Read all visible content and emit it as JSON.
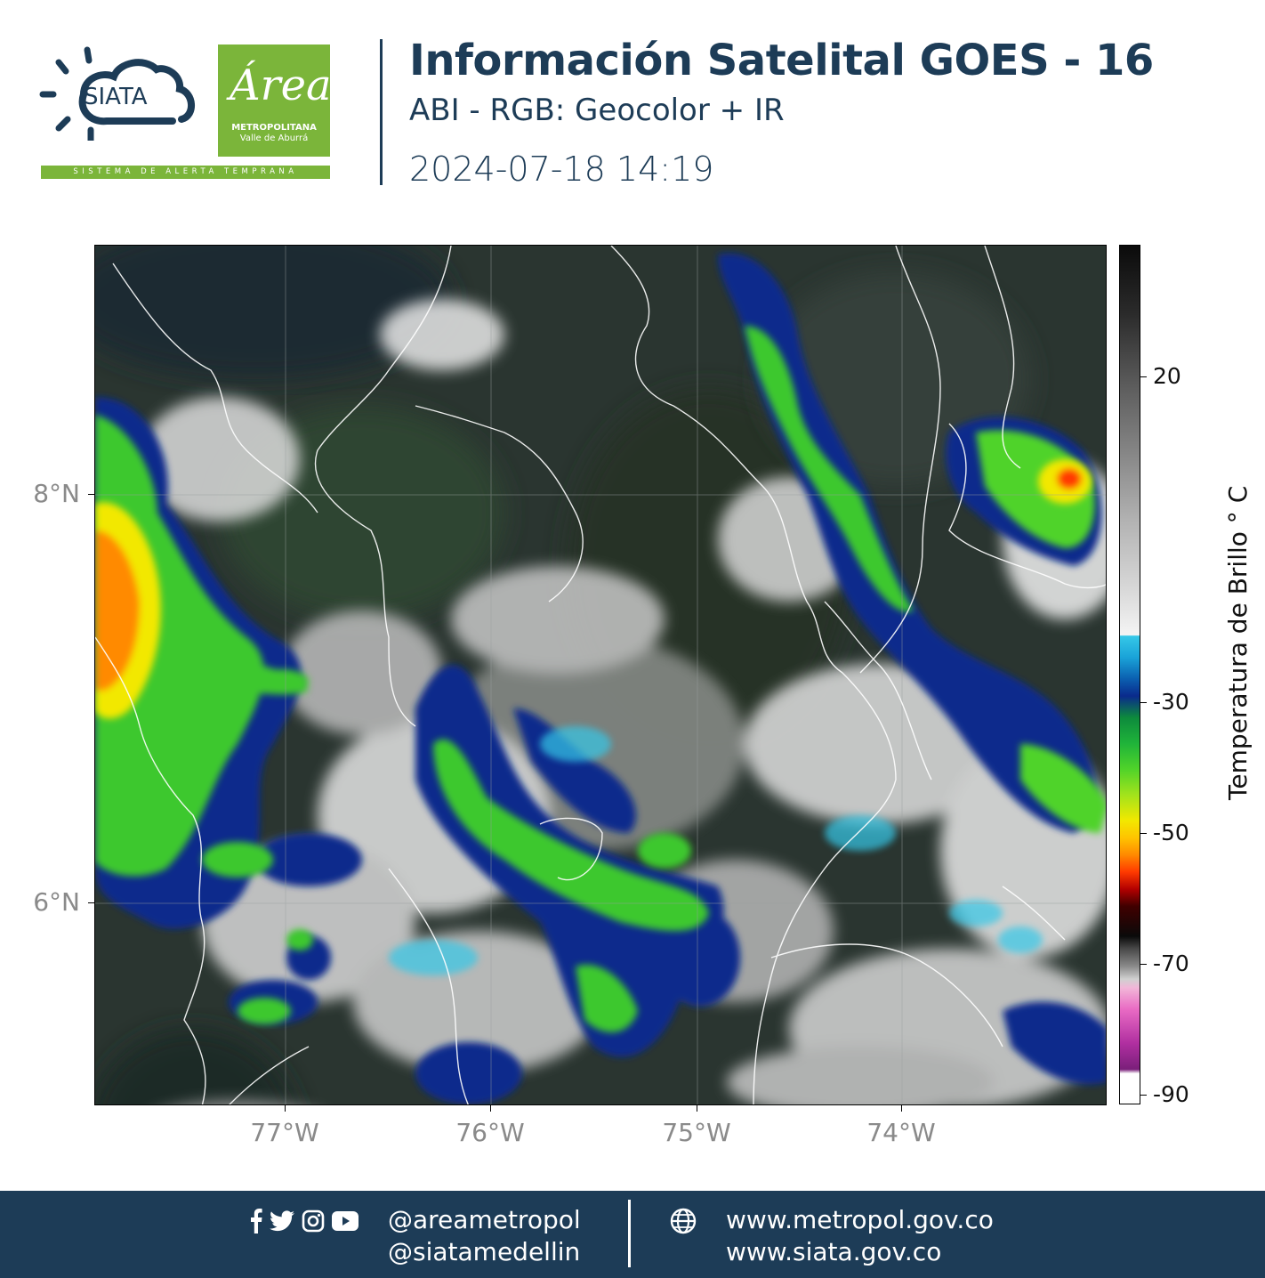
{
  "header": {
    "siata_logo_text": "SIATA",
    "siata_tagline": "SISTEMA DE ALERTA TEMPRANA",
    "area_logo_script": "Área",
    "area_logo_line1": "METROPOLITANA",
    "area_logo_line2": "Valle de Aburrá",
    "title": "Información Satelital GOES - 16",
    "subtitle": "ABI - RGB: Geocolor + IR",
    "datetime": "2024-07-18 14:19"
  },
  "map": {
    "lat_labels": [
      "8°N",
      "6°N"
    ],
    "lon_labels": [
      "77°W",
      "76°W",
      "75°W",
      "74°W"
    ],
    "latitudes": [
      8,
      6
    ],
    "longitudes": [
      -77,
      -76,
      -75,
      -74
    ],
    "lon_range": [
      -77.93,
      -73.0
    ],
    "lat_range": [
      4.95,
      9.15
    ]
  },
  "colorbar": {
    "title": "Temperatura de Brillo ° C",
    "ticks": [
      "20",
      "-30",
      "-50",
      "-70",
      "-90"
    ],
    "tick_values": [
      20,
      -30,
      -50,
      -70,
      -90
    ],
    "range": [
      35,
      -90
    ],
    "ir_colors": [
      "#35c8e8",
      "#0b5fb0",
      "#0a2a8c",
      "#1fb33a",
      "#4fd32a",
      "#f2e800",
      "#ff8a00",
      "#b30000",
      "#e96bc4",
      "#7a1f7a"
    ]
  },
  "footer": {
    "social_icons": [
      "facebook-icon",
      "twitter-icon",
      "instagram-icon",
      "youtube-icon"
    ],
    "handle_1": "@areametropol",
    "handle_2": "@siatamedellin",
    "web_1": "www.metropol.gov.co",
    "web_2": "www.siata.gov.co",
    "background": "#1d3c57"
  }
}
